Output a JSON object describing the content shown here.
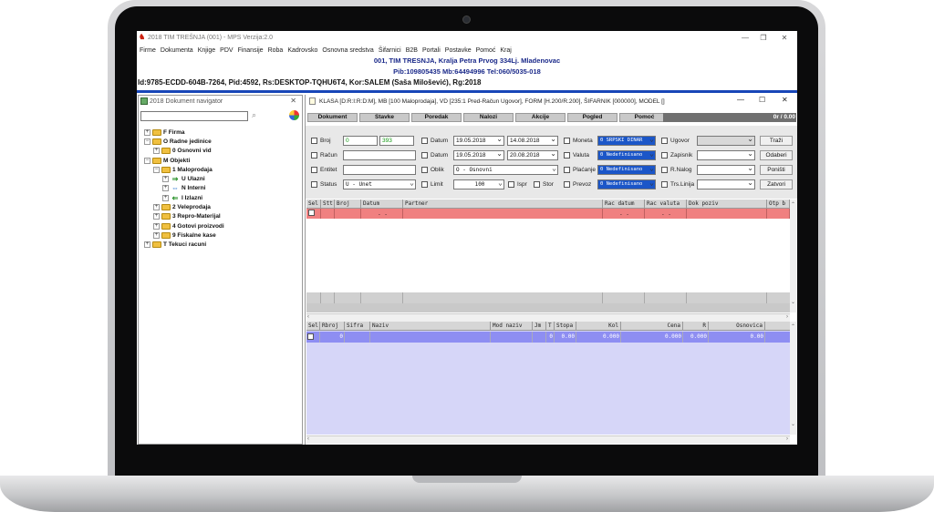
{
  "window": {
    "title": "2018 TIM TREŠNJA (001) - MPS Verzija:2.0",
    "minimize": "—",
    "restore": "❐",
    "close": "✕"
  },
  "menu": [
    "Firme",
    "Dokumenta",
    "Knjige",
    "PDV",
    "Finansije",
    "Roba",
    "Kadrovsko",
    "Osnovna sredstva",
    "Šifarnici",
    "B2B",
    "Portali",
    "Postavke",
    "Pomoć",
    "Kraj"
  ],
  "info": {
    "line1": "001, TIM TRESNJA, Kralja Petra Prvog 334Lj. Mladenovac",
    "line2": "Pib:109805435 Mb:64494996 Tel:060/5035-018",
    "line3": "Id:9785-ECDD-604B-7264, Pid:4592, Rs:DESKTOP-TQHU6T4, Kor:SALEM (Saša Milošević), Rg:2018"
  },
  "navigator": {
    "title": "2018 Dokument navigator",
    "close": "✕",
    "search_value": "",
    "tree": [
      {
        "label": "F Firma",
        "level": 0,
        "icon": "folder",
        "expander": "+"
      },
      {
        "label": "O Radne jedinice",
        "level": 0,
        "icon": "folder",
        "expander": "−"
      },
      {
        "label": "0 Osnovni vid",
        "level": 1,
        "icon": "folder",
        "expander": "+"
      },
      {
        "label": "M Objekti",
        "level": 0,
        "icon": "folder",
        "expander": "−"
      },
      {
        "label": "1 Maloprodaja",
        "level": 1,
        "icon": "folder",
        "expander": "−"
      },
      {
        "label": "U Ulazni",
        "level": 2,
        "icon": "arrow-in",
        "expander": "+"
      },
      {
        "label": "N Interni",
        "level": 2,
        "icon": "arrow-both",
        "expander": "+"
      },
      {
        "label": "I Izlazni",
        "level": 2,
        "icon": "arrow-out",
        "expander": "+"
      },
      {
        "label": "2 Veleprodaja",
        "level": 1,
        "icon": "folder",
        "expander": "+"
      },
      {
        "label": "3 Repro-Materijal",
        "level": 1,
        "icon": "folder",
        "expander": "+"
      },
      {
        "label": "4 Gotovi proizvodi",
        "level": 1,
        "icon": "folder",
        "expander": "+"
      },
      {
        "label": "9 Fiskalne kase",
        "level": 1,
        "icon": "folder",
        "expander": "+"
      },
      {
        "label": "T Tekuci racuni",
        "level": 0,
        "icon": "folder",
        "expander": "+"
      }
    ]
  },
  "document": {
    "title": "KLASA [D:R:I:R:D:M], MB [100 Maloprodaja], VD [235:1 Pred-Račun Ugovor], FORM [H.200/R.200], ŠIFARNIK [000000], MODEL []",
    "minimize": "—",
    "maximize": "☐",
    "close": "✕",
    "tabs": [
      "Dokument",
      "Stavke",
      "Poredak",
      "Nalozi",
      "Akcije",
      "Pogled",
      "Pomoć"
    ],
    "counter": "0r / 0.00",
    "filters": {
      "broj_label": "Broj",
      "broj_from": "0",
      "broj_to": "393",
      "racun_label": "Račun",
      "entitet_label": "Entitet",
      "status_label": "Status",
      "status_value": "U - Unet",
      "datum1_label": "Datum",
      "datum1_from": "19.05.2018",
      "datum1_to": "14.08.2018",
      "datum2_label": "Datum",
      "datum2_from": "19.05.2018",
      "datum2_to": "20.08.2018",
      "oblik_label": "Oblik",
      "oblik_value": "O - Osnovni",
      "limit_label": "Limit",
      "limit_value": "100",
      "ispr_label": "Ispr",
      "stor_label": "Stor",
      "moneta_label": "Moneta",
      "moneta_value": "0 SRPSKI DINAR",
      "valuta_label": "Valuta",
      "valuta_value": "0 Nedefinisano",
      "placanje_label": "Plaćanje",
      "placanje_value": "0 Nedefinisano",
      "prevoz_label": "Prevoz",
      "prevoz_value": "0 Nedefinisano",
      "ugovor_label": "Ugovor",
      "zapisnik_label": "Zapisnik",
      "rnalog_label": "R.Nalog",
      "trslinija_label": "Trs.Linija"
    },
    "buttons": {
      "trazi": "Traži",
      "odaberi": "Odaberi",
      "ponisti": "Poništi",
      "zatvori": "Zatvori"
    },
    "grid1": {
      "headers": [
        "Sel",
        "Stt",
        "Broj",
        "Datum",
        "Partner",
        "Rac datum",
        "Rac valuta",
        "Dok poziv",
        "Otp b"
      ],
      "row": [
        "",
        "",
        "",
        ".  .",
        "",
        ".  .",
        ".  .",
        "",
        ""
      ]
    },
    "grid2": {
      "headers": [
        "Sel",
        "Rbroj",
        "Sifra",
        "Naziv",
        "Mod naziv",
        "Jm",
        "T",
        "Stopa",
        "Kol",
        "Cena",
        "R",
        "Osnovica"
      ],
      "row": [
        "",
        "0",
        "",
        "",
        "",
        "",
        "0",
        "0.00",
        "0.000",
        "0.000",
        "0.000",
        "0.00"
      ]
    }
  }
}
